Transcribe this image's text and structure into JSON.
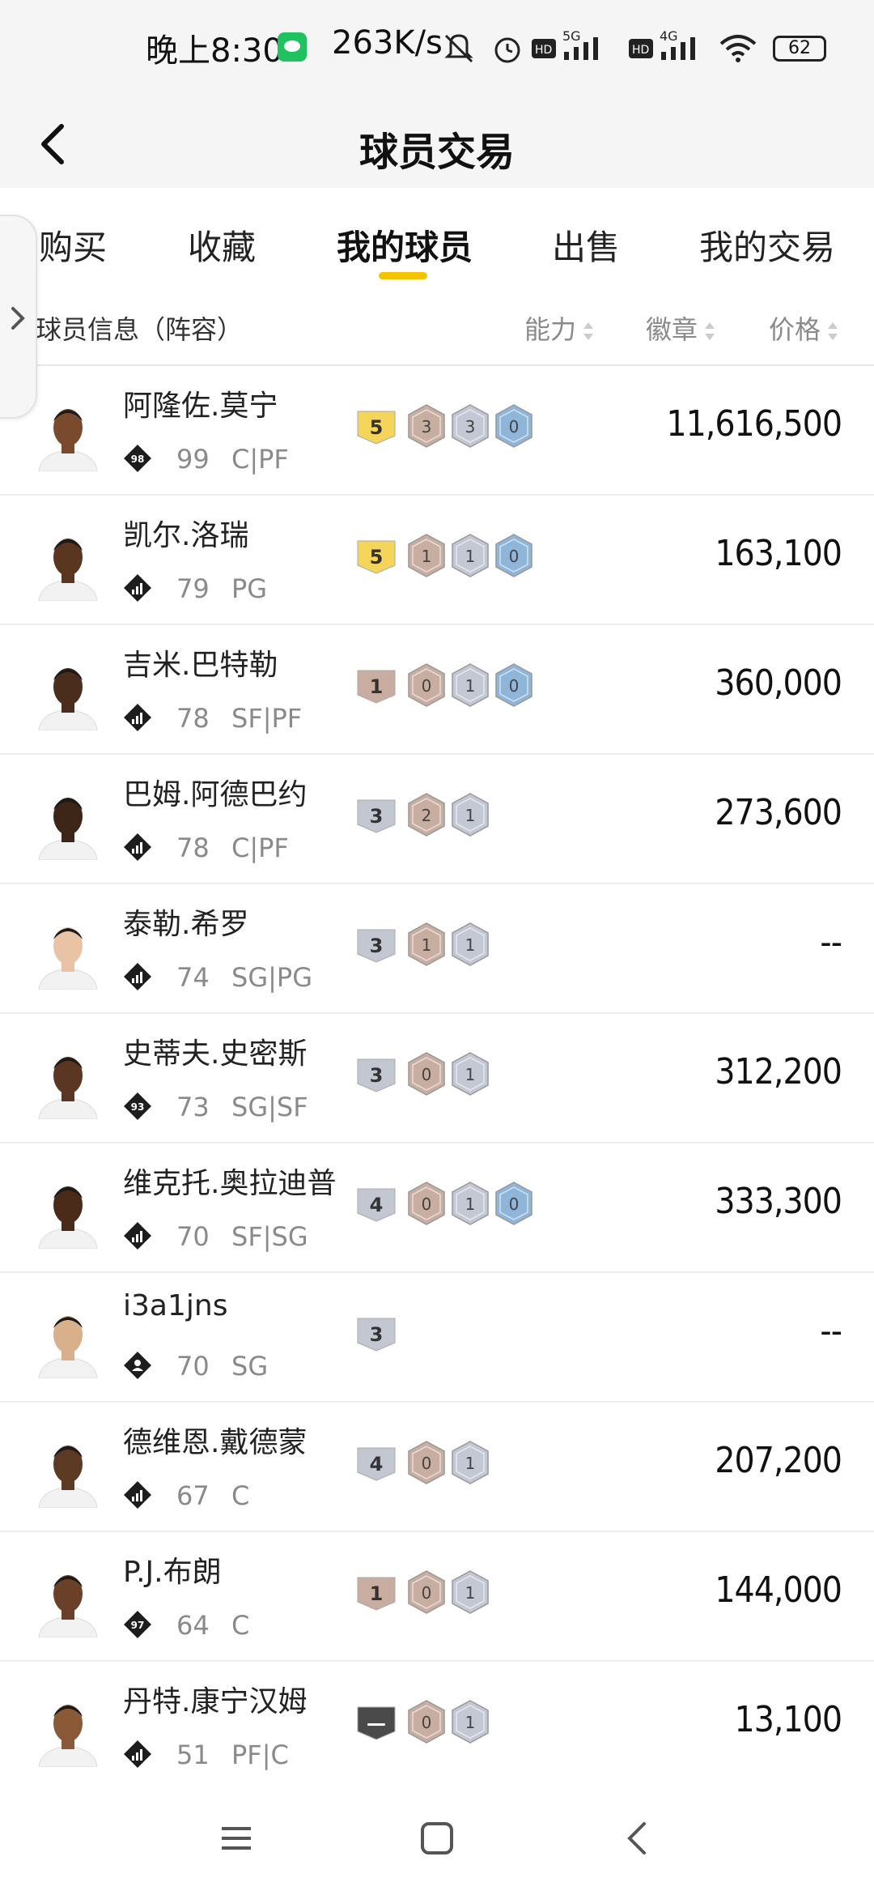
{
  "status_bar": {
    "time": "晚上8:30",
    "net_speed": "263K/s",
    "battery": "62"
  },
  "header": {
    "title": "球员交易"
  },
  "tabs": [
    {
      "label": "购买",
      "active": false
    },
    {
      "label": "收藏",
      "active": false
    },
    {
      "label": "我的球员",
      "active": true
    },
    {
      "label": "出售",
      "active": false
    },
    {
      "label": "我的交易",
      "active": false
    }
  ],
  "columns": {
    "info": "球员信息（阵容）",
    "ability": "能力",
    "badge": "徽章",
    "price": "价格"
  },
  "colors": {
    "accent": "#f2c500",
    "tier_gold": "#f5d45a",
    "tier_bronze": "#c9ada0",
    "tier_silver": "#c3c7d2",
    "tier_dark": "#4a4a4a",
    "badge_bronze": "#c7aea0",
    "badge_silver": "#c4c8d4",
    "badge_blue": "#8fb6d8"
  },
  "players": [
    {
      "name": "阿隆佐.莫宁",
      "ovr": "99",
      "pos": "C|PF",
      "tier_icon": "diamond-98-icon",
      "tier_num": "98",
      "ability": "5",
      "ability_color": "gold",
      "badges": [
        "3",
        "3",
        "0"
      ],
      "price": "11,616,500"
    },
    {
      "name": "凯尔.洛瑞",
      "ovr": "79",
      "pos": "PG",
      "tier_icon": "diamond-bars-icon",
      "tier_num": "",
      "ability": "5",
      "ability_color": "gold",
      "badges": [
        "1",
        "1",
        "0"
      ],
      "price": "163,100"
    },
    {
      "name": "吉米.巴特勒",
      "ovr": "78",
      "pos": "SF|PF",
      "tier_icon": "diamond-bars-icon",
      "tier_num": "",
      "ability": "1",
      "ability_color": "bronze",
      "badges": [
        "0",
        "1",
        "0"
      ],
      "price": "360,000"
    },
    {
      "name": "巴姆.阿德巴约",
      "ovr": "78",
      "pos": "C|PF",
      "tier_icon": "diamond-bars-icon",
      "tier_num": "",
      "ability": "3",
      "ability_color": "silver",
      "badges": [
        "2",
        "1"
      ],
      "price": "273,600"
    },
    {
      "name": "泰勒.希罗",
      "ovr": "74",
      "pos": "SG|PG",
      "tier_icon": "diamond-bars-icon",
      "tier_num": "",
      "ability": "3",
      "ability_color": "silver",
      "badges": [
        "1",
        "1"
      ],
      "price": "--"
    },
    {
      "name": "史蒂夫.史密斯",
      "ovr": "73",
      "pos": "SG|SF",
      "tier_icon": "diamond-93-icon",
      "tier_num": "93",
      "ability": "3",
      "ability_color": "silver",
      "badges": [
        "0",
        "1"
      ],
      "price": "312,200"
    },
    {
      "name": "维克托.奥拉迪普",
      "ovr": "70",
      "pos": "SF|SG",
      "tier_icon": "diamond-bars-icon",
      "tier_num": "",
      "ability": "4",
      "ability_color": "silver",
      "badges": [
        "0",
        "1",
        "0"
      ],
      "price": "333,300"
    },
    {
      "name": "i3a1jns",
      "ovr": "70",
      "pos": "SG",
      "tier_icon": "diamond-person-icon",
      "tier_num": "",
      "ability": "3",
      "ability_color": "silver",
      "badges": [],
      "price": "--"
    },
    {
      "name": "德维恩.戴德蒙",
      "ovr": "67",
      "pos": "C",
      "tier_icon": "diamond-bars-icon",
      "tier_num": "",
      "ability": "4",
      "ability_color": "silver",
      "badges": [
        "0",
        "1"
      ],
      "price": "207,200"
    },
    {
      "name": "P.J.布朗",
      "ovr": "64",
      "pos": "C",
      "tier_icon": "diamond-97-icon",
      "tier_num": "97",
      "ability": "1",
      "ability_color": "bronze",
      "badges": [
        "0",
        "1"
      ],
      "price": "144,000"
    },
    {
      "name": "丹特.康宁汉姆",
      "ovr": "51",
      "pos": "PF|C",
      "tier_icon": "diamond-bars-icon",
      "tier_num": "",
      "ability": "—",
      "ability_color": "dark",
      "badges": [
        "0",
        "1"
      ],
      "price": "13,100"
    }
  ]
}
